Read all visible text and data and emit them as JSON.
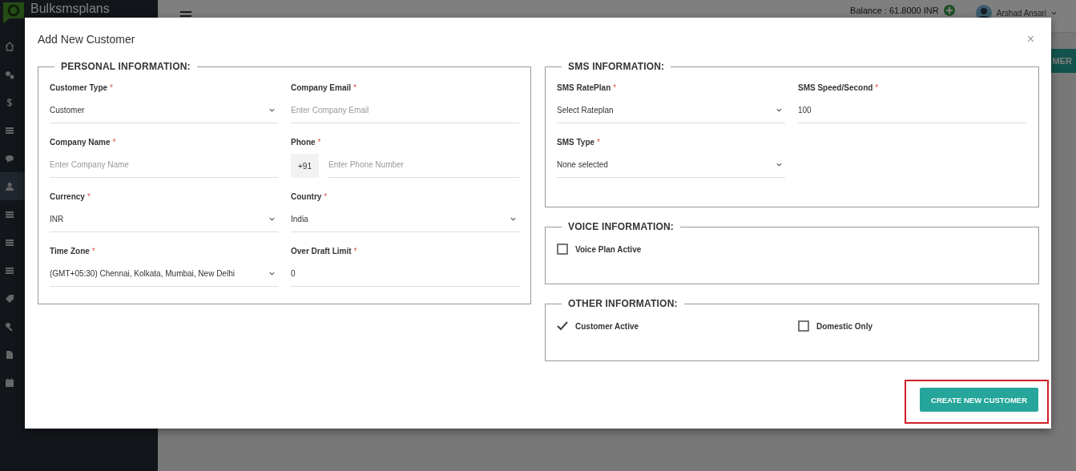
{
  "topbar": {
    "logo": "Bulksmsplans",
    "balance": "Balance : 61.8000 INR",
    "user": "Arshad Ansari"
  },
  "sidebar": {
    "items": [
      {
        "kind": "home",
        "selected": false
      },
      {
        "kind": "gears",
        "selected": false
      },
      {
        "kind": "dollar",
        "selected": false
      },
      {
        "kind": "list",
        "selected": false
      },
      {
        "kind": "chat",
        "selected": false
      },
      {
        "kind": "user",
        "selected": true
      },
      {
        "kind": "list",
        "selected": false
      },
      {
        "kind": "list",
        "selected": false
      },
      {
        "kind": "list",
        "selected": false
      },
      {
        "kind": "tag",
        "selected": false
      },
      {
        "kind": "key",
        "selected": false
      },
      {
        "kind": "file",
        "selected": false
      },
      {
        "kind": "calendar",
        "selected": false
      }
    ]
  },
  "page_button": "MER",
  "modal": {
    "title": "Add New Customer",
    "close": "×",
    "personal": {
      "legend": "PERSONAL INFORMATION:",
      "fields": [
        {
          "kind": "select",
          "label": "Customer Type",
          "mark": "*",
          "value": "Customer"
        },
        {
          "kind": "input",
          "label": "Company Email",
          "mark": "*",
          "placeholder": "Enter Company Email"
        },
        {
          "kind": "input",
          "label": "Company Name",
          "mark": "*",
          "placeholder": "Enter Company Name"
        },
        {
          "kind": "phone",
          "label": "Phone",
          "mark": "*",
          "prefix": "+91",
          "placeholder": "Enter Phone Number"
        },
        {
          "kind": "select",
          "label": "Currency",
          "mark": "*",
          "value": "INR"
        },
        {
          "kind": "select",
          "label": "Country",
          "mark": "*",
          "value": "India"
        },
        {
          "kind": "select",
          "label": "Time Zone",
          "mark": "*",
          "value": "(GMT+05:30) Chennai, Kolkata, Mumbai, New Delhi"
        },
        {
          "kind": "input",
          "label": "Over Draft Limit",
          "mark": "*",
          "value": "0"
        }
      ]
    },
    "sms": {
      "legend": "SMS INFORMATION:",
      "fields": [
        {
          "kind": "select",
          "label": "SMS RatePlan",
          "mark": "*",
          "value": "Select Rateplan"
        },
        {
          "kind": "input",
          "label": "SMS Speed/Second",
          "mark": "*",
          "value": "100"
        },
        {
          "kind": "select",
          "label": "SMS Type",
          "mark": "*",
          "value": "None selected"
        }
      ]
    },
    "voice": {
      "legend": "VOICE INFORMATION:",
      "checks": [
        {
          "label": "Voice Plan Active",
          "checked": false
        }
      ]
    },
    "other": {
      "legend": "OTHER INFORMATION:",
      "checks": [
        {
          "label": "Customer Active",
          "checked": true
        },
        {
          "label": "Domestic Only",
          "checked": false
        }
      ]
    },
    "submit": {
      "label": "CREATE NEW CUSTOMER",
      "highlighted": true
    }
  }
}
